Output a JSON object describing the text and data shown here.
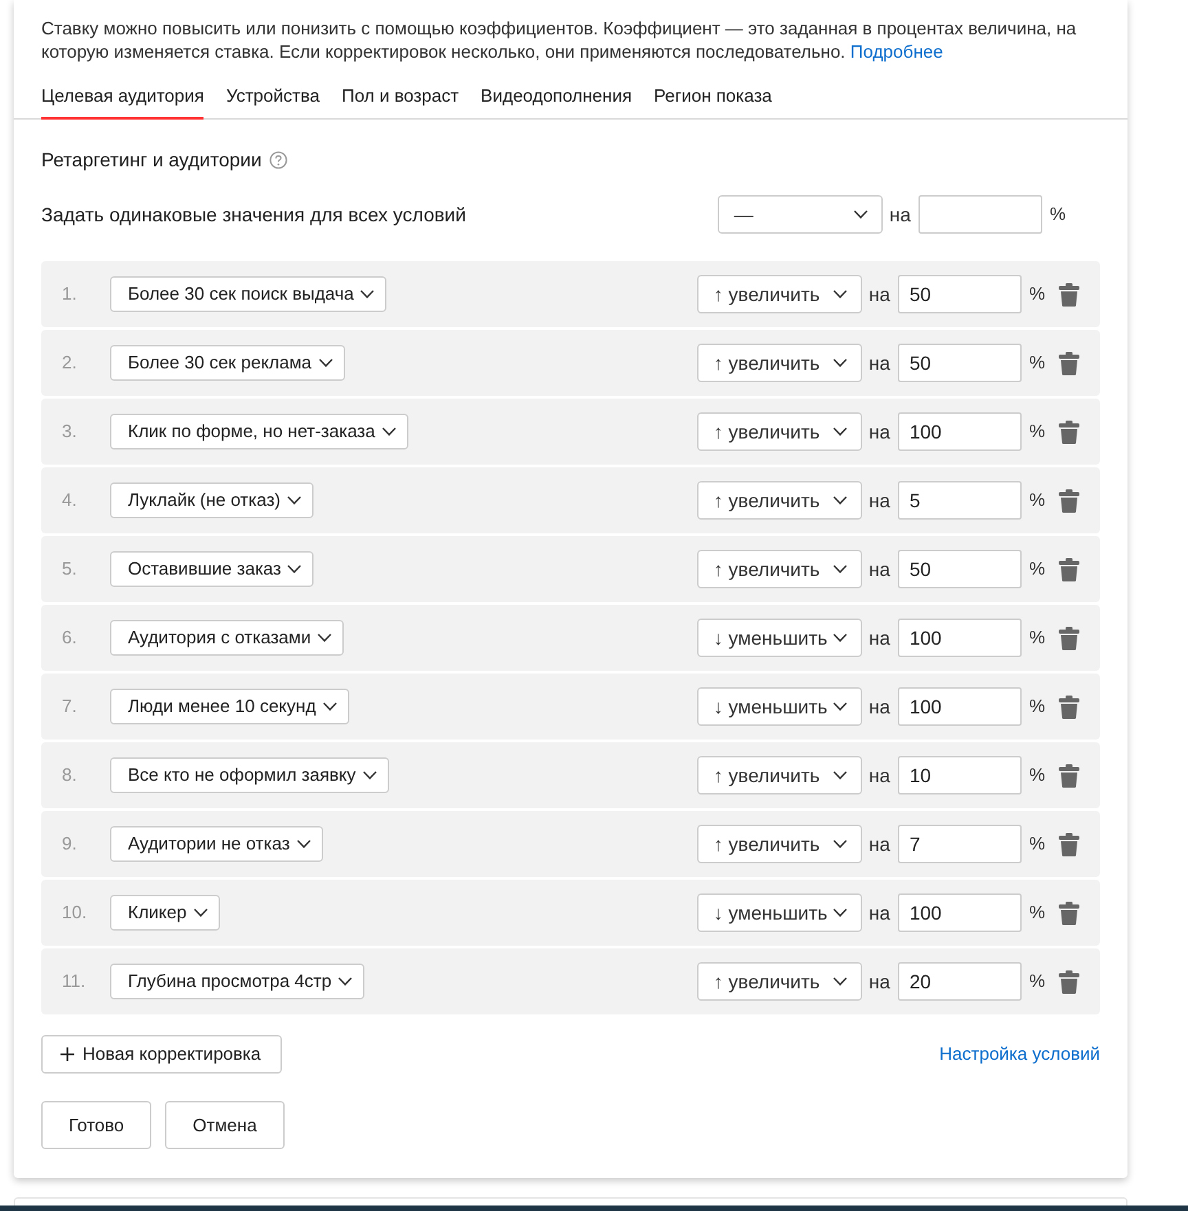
{
  "description": {
    "text": "Ставку можно повысить или понизить с помощью коэффициентов. Коэффициент — это заданная в процентах величина, на которую изменяется ставка. Если корректировок несколько, они применяются последовательно.",
    "link": "Подробнее"
  },
  "tabs": [
    {
      "label": "Целевая аудитория",
      "selected": true
    },
    {
      "label": "Устройства",
      "selected": false
    },
    {
      "label": "Пол и возраст",
      "selected": false
    },
    {
      "label": "Видеодополнения",
      "selected": false
    },
    {
      "label": "Регион показа",
      "selected": false
    }
  ],
  "section": {
    "title": "Ретаргетинг и аудитории"
  },
  "bulk": {
    "label": "Задать одинаковые значения для всех условий",
    "direction": "—",
    "on": "на",
    "unit": "%"
  },
  "rows": [
    {
      "number": "1.",
      "audience": "Более 30 сек поиск выдача",
      "direction": "↑ увеличить",
      "on": "на",
      "value": "50",
      "unit": "%"
    },
    {
      "number": "2.",
      "audience": "Более 30 сек реклама",
      "direction": "↑ увеличить",
      "on": "на",
      "value": "50",
      "unit": "%"
    },
    {
      "number": "3.",
      "audience": "Клик по форме, но нет-заказа",
      "direction": "↑ увеличить",
      "on": "на",
      "value": "100",
      "unit": "%"
    },
    {
      "number": "4.",
      "audience": "Луклайк (не отказ)",
      "direction": "↑ увеличить",
      "on": "на",
      "value": "5",
      "unit": "%"
    },
    {
      "number": "5.",
      "audience": "Оставившие заказ",
      "direction": "↑ увеличить",
      "on": "на",
      "value": "50",
      "unit": "%"
    },
    {
      "number": "6.",
      "audience": "Аудитория с отказами",
      "direction": "↓ уменьшить",
      "on": "на",
      "value": "100",
      "unit": "%"
    },
    {
      "number": "7.",
      "audience": "Люди менее 10 секунд",
      "direction": "↓ уменьшить",
      "on": "на",
      "value": "100",
      "unit": "%"
    },
    {
      "number": "8.",
      "audience": "Все кто не оформил заявку",
      "direction": "↑ увеличить",
      "on": "на",
      "value": "10",
      "unit": "%"
    },
    {
      "number": "9.",
      "audience": "Аудитории не отказ",
      "direction": "↑ увеличить",
      "on": "на",
      "value": "7",
      "unit": "%"
    },
    {
      "number": "10.",
      "audience": "Кликер",
      "direction": "↓ уменьшить",
      "on": "на",
      "value": "100",
      "unit": "%"
    },
    {
      "number": "11.",
      "audience": "Глубина просмотра 4стр",
      "direction": "↑ увеличить",
      "on": "на",
      "value": "20",
      "unit": "%"
    }
  ],
  "actions": {
    "add": "Новая корректировка",
    "settings_link": "Настройка условий"
  },
  "buttons": [
    "Готово",
    "Отмена"
  ]
}
